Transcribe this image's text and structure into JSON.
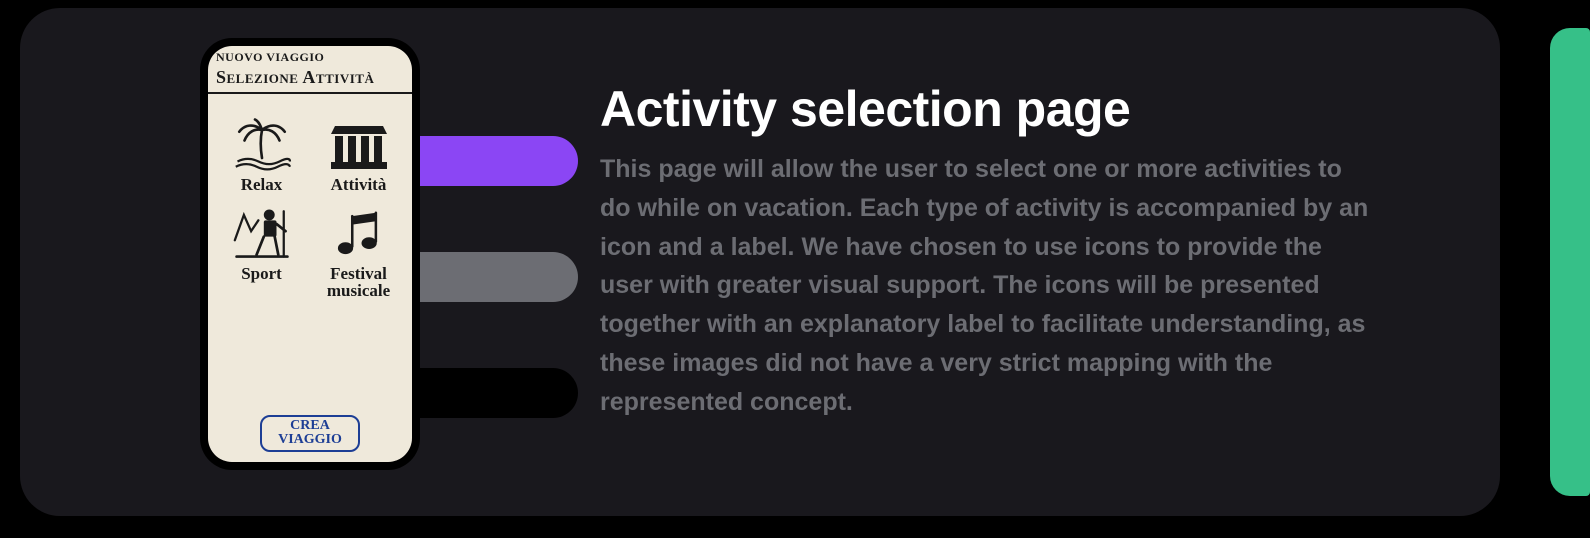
{
  "sketch": {
    "header_small": "NUOVO VIAGGIO",
    "title": "Selezione Attività",
    "activities": [
      {
        "icon": "palm",
        "label": "Relax"
      },
      {
        "icon": "temple",
        "label": "Attività"
      },
      {
        "icon": "hiker",
        "label": "Sport"
      },
      {
        "icon": "music",
        "label": "Festival\nmusicale"
      }
    ],
    "cta": "CREA\nVIAGGIO"
  },
  "content": {
    "heading": "Activity selection page",
    "body": "This page will allow the user to select one or more activities to do while on vacation. Each type of activity is accompanied by an icon and a label. We have chosen to use icons to provide the user with greater visual support. The icons will be presented together with an explanatory label to facilitate understanding, as these images did not have a very strict mapping with the represented concept."
  },
  "colors": {
    "accent_purple": "#8b46f4",
    "accent_grey": "#6c6d73",
    "accent_black": "#000000",
    "accent_green": "#36c088"
  }
}
